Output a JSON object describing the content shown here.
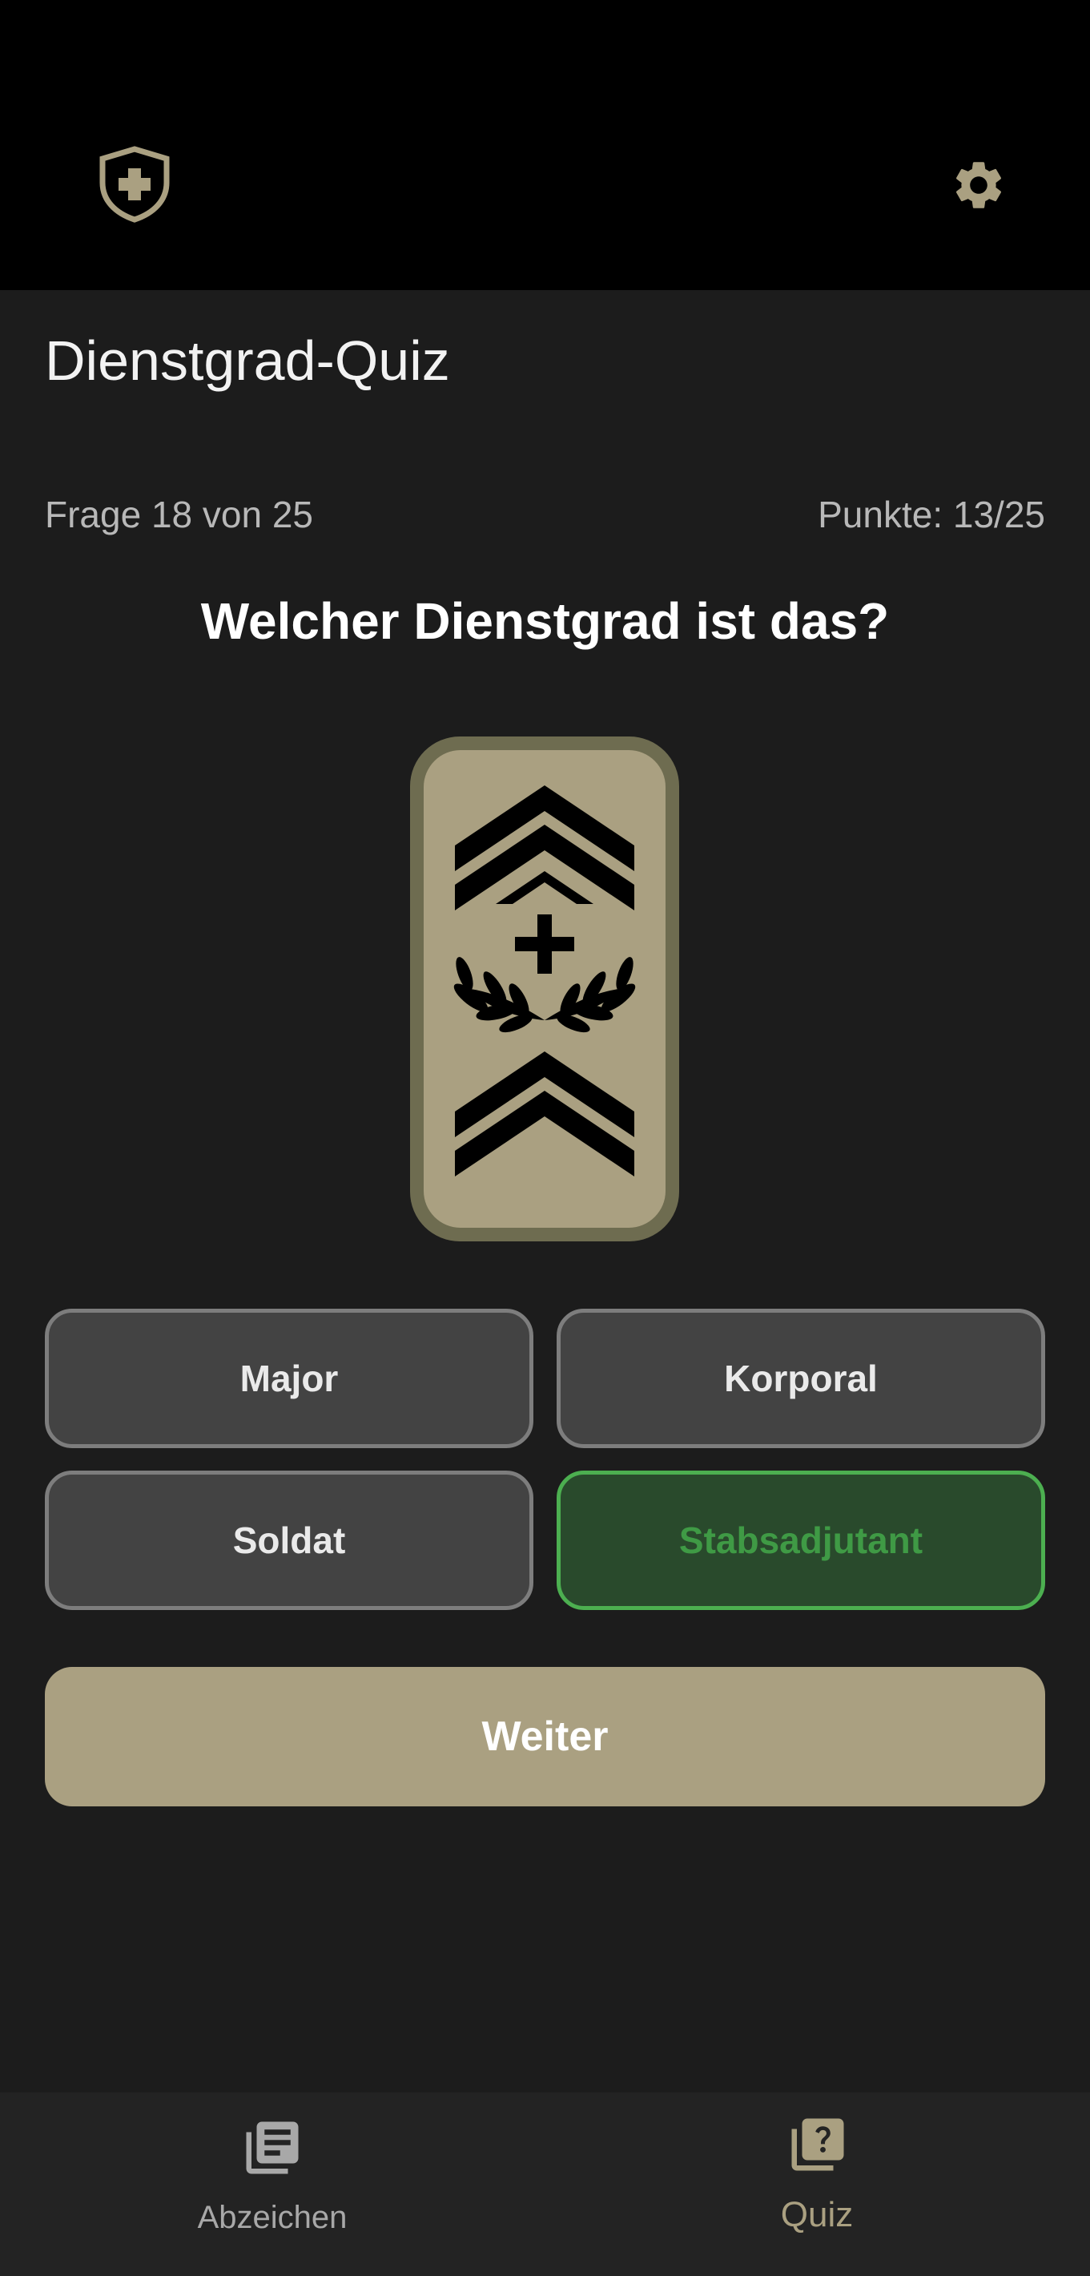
{
  "header": {
    "logo_icon": "swiss-shield-icon",
    "settings_icon": "gear-icon",
    "accent_color": "#aaa081"
  },
  "page": {
    "title": "Dienstgrad-Quiz",
    "question_counter": "Frage 18 von 25",
    "score": "Punkte: 13/25",
    "question": "Welcher Dienstgrad ist das?"
  },
  "insignia": {
    "icon": "stabsadjutant-rank-insignia",
    "colors": {
      "border": "#6e6c50",
      "fill": "#aaa081",
      "emblem": "#000000"
    }
  },
  "answers": [
    {
      "label": "Major",
      "state": "neutral"
    },
    {
      "label": "Korporal",
      "state": "neutral"
    },
    {
      "label": "Soldat",
      "state": "neutral"
    },
    {
      "label": "Stabsadjutant",
      "state": "correct",
      "color": "#4caf50"
    }
  ],
  "actions": {
    "next_label": "Weiter"
  },
  "bottom_nav": {
    "items": [
      {
        "label": "Abzeichen",
        "icon": "list-stack-icon",
        "active": false
      },
      {
        "label": "Quiz",
        "icon": "quiz-question-icon",
        "active": true
      }
    ]
  }
}
